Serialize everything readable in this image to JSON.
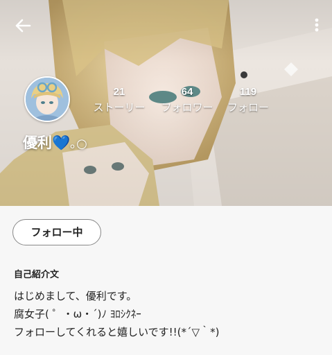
{
  "topbar": {
    "back_icon": "arrow-left-icon",
    "menu_icon": "more-vertical-icon"
  },
  "profile": {
    "name": "優利",
    "name_heart": "💙",
    "name_suffix": "｡○",
    "avatar_icon": "avatar-image"
  },
  "stats": {
    "stories_count": "21",
    "stories_label": "ストーリー",
    "following_count": "64",
    "following_label": "フォロワー",
    "followers_count": "119",
    "followers_label": "フォロー"
  },
  "actions": {
    "follow_label": "フォロー中"
  },
  "bio": {
    "heading": "自己紹介文",
    "lines": [
      "はじめまして、優利です。",
      "腐女子( ゜・ω・´)ﾉ ﾖﾛｼｸﾈｰ",
      "フォローしてくれると嬉しいです!!(*´▽｀*)"
    ]
  },
  "colors": {
    "heart": "#1a2fe0",
    "text": "#222222",
    "background": "#f7f7f7",
    "button_border": "#888888"
  }
}
